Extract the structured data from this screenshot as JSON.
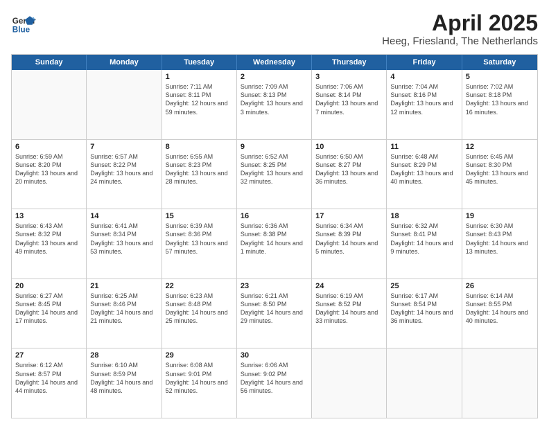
{
  "logo": {
    "general": "General",
    "blue": "Blue"
  },
  "title": "April 2025",
  "subtitle": "Heeg, Friesland, The Netherlands",
  "weekdays": [
    "Sunday",
    "Monday",
    "Tuesday",
    "Wednesday",
    "Thursday",
    "Friday",
    "Saturday"
  ],
  "rows": [
    [
      {
        "day": "",
        "info": ""
      },
      {
        "day": "",
        "info": ""
      },
      {
        "day": "1",
        "info": "Sunrise: 7:11 AM\nSunset: 8:11 PM\nDaylight: 12 hours and 59 minutes."
      },
      {
        "day": "2",
        "info": "Sunrise: 7:09 AM\nSunset: 8:13 PM\nDaylight: 13 hours and 3 minutes."
      },
      {
        "day": "3",
        "info": "Sunrise: 7:06 AM\nSunset: 8:14 PM\nDaylight: 13 hours and 7 minutes."
      },
      {
        "day": "4",
        "info": "Sunrise: 7:04 AM\nSunset: 8:16 PM\nDaylight: 13 hours and 12 minutes."
      },
      {
        "day": "5",
        "info": "Sunrise: 7:02 AM\nSunset: 8:18 PM\nDaylight: 13 hours and 16 minutes."
      }
    ],
    [
      {
        "day": "6",
        "info": "Sunrise: 6:59 AM\nSunset: 8:20 PM\nDaylight: 13 hours and 20 minutes."
      },
      {
        "day": "7",
        "info": "Sunrise: 6:57 AM\nSunset: 8:22 PM\nDaylight: 13 hours and 24 minutes."
      },
      {
        "day": "8",
        "info": "Sunrise: 6:55 AM\nSunset: 8:23 PM\nDaylight: 13 hours and 28 minutes."
      },
      {
        "day": "9",
        "info": "Sunrise: 6:52 AM\nSunset: 8:25 PM\nDaylight: 13 hours and 32 minutes."
      },
      {
        "day": "10",
        "info": "Sunrise: 6:50 AM\nSunset: 8:27 PM\nDaylight: 13 hours and 36 minutes."
      },
      {
        "day": "11",
        "info": "Sunrise: 6:48 AM\nSunset: 8:29 PM\nDaylight: 13 hours and 40 minutes."
      },
      {
        "day": "12",
        "info": "Sunrise: 6:45 AM\nSunset: 8:30 PM\nDaylight: 13 hours and 45 minutes."
      }
    ],
    [
      {
        "day": "13",
        "info": "Sunrise: 6:43 AM\nSunset: 8:32 PM\nDaylight: 13 hours and 49 minutes."
      },
      {
        "day": "14",
        "info": "Sunrise: 6:41 AM\nSunset: 8:34 PM\nDaylight: 13 hours and 53 minutes."
      },
      {
        "day": "15",
        "info": "Sunrise: 6:39 AM\nSunset: 8:36 PM\nDaylight: 13 hours and 57 minutes."
      },
      {
        "day": "16",
        "info": "Sunrise: 6:36 AM\nSunset: 8:38 PM\nDaylight: 14 hours and 1 minute."
      },
      {
        "day": "17",
        "info": "Sunrise: 6:34 AM\nSunset: 8:39 PM\nDaylight: 14 hours and 5 minutes."
      },
      {
        "day": "18",
        "info": "Sunrise: 6:32 AM\nSunset: 8:41 PM\nDaylight: 14 hours and 9 minutes."
      },
      {
        "day": "19",
        "info": "Sunrise: 6:30 AM\nSunset: 8:43 PM\nDaylight: 14 hours and 13 minutes."
      }
    ],
    [
      {
        "day": "20",
        "info": "Sunrise: 6:27 AM\nSunset: 8:45 PM\nDaylight: 14 hours and 17 minutes."
      },
      {
        "day": "21",
        "info": "Sunrise: 6:25 AM\nSunset: 8:46 PM\nDaylight: 14 hours and 21 minutes."
      },
      {
        "day": "22",
        "info": "Sunrise: 6:23 AM\nSunset: 8:48 PM\nDaylight: 14 hours and 25 minutes."
      },
      {
        "day": "23",
        "info": "Sunrise: 6:21 AM\nSunset: 8:50 PM\nDaylight: 14 hours and 29 minutes."
      },
      {
        "day": "24",
        "info": "Sunrise: 6:19 AM\nSunset: 8:52 PM\nDaylight: 14 hours and 33 minutes."
      },
      {
        "day": "25",
        "info": "Sunrise: 6:17 AM\nSunset: 8:54 PM\nDaylight: 14 hours and 36 minutes."
      },
      {
        "day": "26",
        "info": "Sunrise: 6:14 AM\nSunset: 8:55 PM\nDaylight: 14 hours and 40 minutes."
      }
    ],
    [
      {
        "day": "27",
        "info": "Sunrise: 6:12 AM\nSunset: 8:57 PM\nDaylight: 14 hours and 44 minutes."
      },
      {
        "day": "28",
        "info": "Sunrise: 6:10 AM\nSunset: 8:59 PM\nDaylight: 14 hours and 48 minutes."
      },
      {
        "day": "29",
        "info": "Sunrise: 6:08 AM\nSunset: 9:01 PM\nDaylight: 14 hours and 52 minutes."
      },
      {
        "day": "30",
        "info": "Sunrise: 6:06 AM\nSunset: 9:02 PM\nDaylight: 14 hours and 56 minutes."
      },
      {
        "day": "",
        "info": ""
      },
      {
        "day": "",
        "info": ""
      },
      {
        "day": "",
        "info": ""
      }
    ]
  ]
}
